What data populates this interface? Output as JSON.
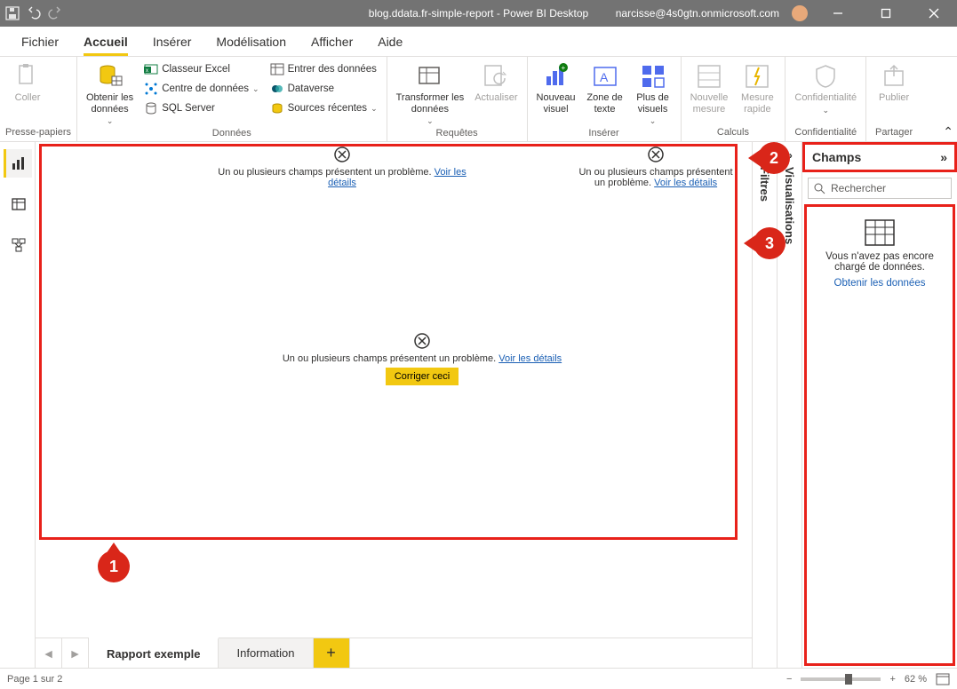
{
  "titlebar": {
    "doc_title": "blog.ddata.fr-simple-report - Power BI Desktop",
    "user_email": "narcisse@4s0gtn.onmicrosoft.com"
  },
  "menu": {
    "file": "Fichier",
    "home": "Accueil",
    "insert": "Insérer",
    "modeling": "Modélisation",
    "view": "Afficher",
    "help": "Aide"
  },
  "ribbon": {
    "clipboard": {
      "paste": "Coller",
      "group": "Presse-papiers"
    },
    "data": {
      "get_data": "Obtenir les\ndonnées",
      "excel": "Classeur Excel",
      "hub": "Centre de données",
      "sql": "SQL Server",
      "enter": "Entrer des données",
      "dataverse": "Dataverse",
      "recent": "Sources récentes",
      "group": "Données"
    },
    "queries": {
      "transform": "Transformer les\ndonnées",
      "refresh": "Actualiser",
      "group": "Requêtes"
    },
    "insert": {
      "new_visual": "Nouveau\nvisuel",
      "text_box": "Zone de\ntexte",
      "more": "Plus de\nvisuels",
      "group": "Insérer"
    },
    "calc": {
      "new_measure": "Nouvelle\nmesure",
      "quick": "Mesure\nrapide",
      "group": "Calculs"
    },
    "sensitivity": {
      "label": "Confidentialité",
      "group": "Confidentialité"
    },
    "share": {
      "publish": "Publier",
      "group": "Partager"
    }
  },
  "canvas": {
    "error_msg": "Un ou plusieurs champs présentent un problème.",
    "error_link": "Voir les détails",
    "fix_btn": "Corriger ceci"
  },
  "panes": {
    "filters": "Filtres",
    "visualizations": "Visualisations",
    "fields_title": "Champs",
    "search_placeholder": "Rechercher",
    "no_data_line1": "Vous n'avez pas encore chargé de données.",
    "get_data_link": "Obtenir les données"
  },
  "tabs": {
    "tab1": "Rapport exemple",
    "tab2": "Information"
  },
  "status": {
    "page": "Page 1 sur 2",
    "zoom": "62 %"
  },
  "markers": {
    "m1": "1",
    "m2": "2",
    "m3": "3"
  }
}
